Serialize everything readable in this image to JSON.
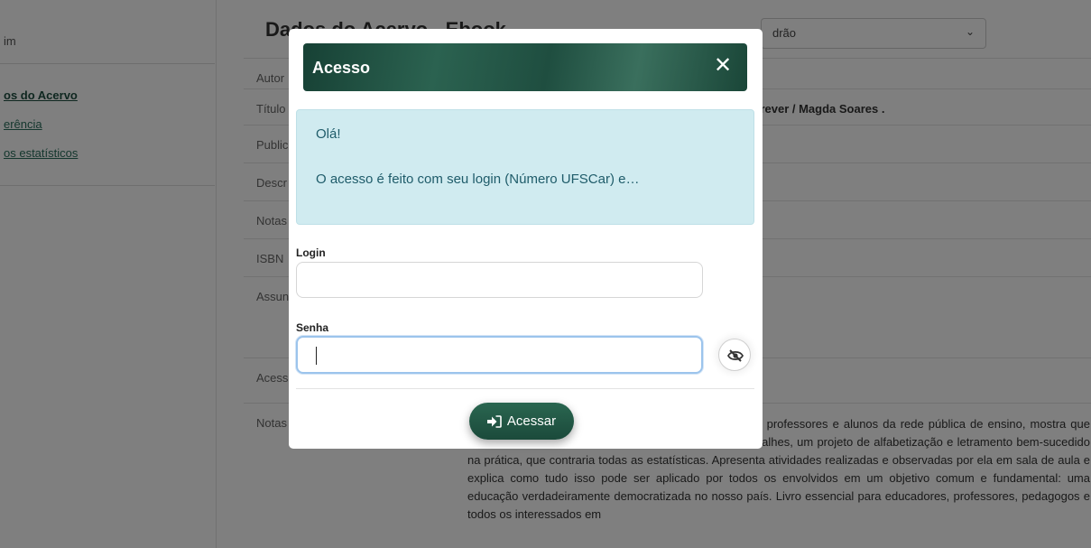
{
  "background": {
    "sidebar": {
      "home": "im",
      "links": [
        {
          "label": "os do Acervo",
          "bold": true
        },
        {
          "label": "erência",
          "bold": false
        },
        {
          "label": "os estatísticos",
          "bold": false
        }
      ]
    },
    "heading": "Dados do Acervo - Ebook",
    "view_select": {
      "value": "drão"
    },
    "rows": [
      {
        "label": "Autor",
        "value": ""
      },
      {
        "label": "Título",
        "value": "screver /  Magda Soares ."
      },
      {
        "label": "Public",
        "value": ""
      },
      {
        "label": "Descr",
        "value": ""
      },
      {
        "label": "Notas",
        "value": ""
      },
      {
        "label": "ISBN",
        "value": ""
      },
      {
        "label": "Assun",
        "value": ""
      },
      {
        "label": "Acess",
        "value": ""
      },
      {
        "label": "Notas",
        "value": ""
      }
    ],
    "description": "e a escrever? Neste livro, a professora Magda Soares, professores e alunos da rede pública de ensino, mostra que sim. Ao longo de seis capítulos, a autora expõe, em detalhes, um projeto de alfabetização e letramento bem-sucedido na prática, que contraria todas as estatísticas. Apresenta atividades realizadas e observadas por ela em sala de aula e explica como tudo isso pode ser aplicado por todos os envolvidos em um objetivo comum e fundamental: uma educação verdadeiramente democratizada no nosso país. Livro essencial para educadores, professores, pedagogos e todos os interessados em"
  },
  "modal": {
    "title": "Acesso",
    "close_icon": "close-icon",
    "alert": {
      "line1": "Olá!",
      "line2": "O acesso é feito com seu login (Número UFSCar) e…"
    },
    "login": {
      "label": "Login",
      "value": ""
    },
    "password": {
      "label": "Senha",
      "value": "",
      "toggle_icon": "eye-slash-icon"
    },
    "submit": {
      "label": "Acessar",
      "icon": "sign-in-icon"
    }
  },
  "colors": {
    "brand": "#1e4f41",
    "alert_bg": "#d0ebf0",
    "alert_text": "#1f5c6a",
    "focus": "#9cc4ec"
  }
}
